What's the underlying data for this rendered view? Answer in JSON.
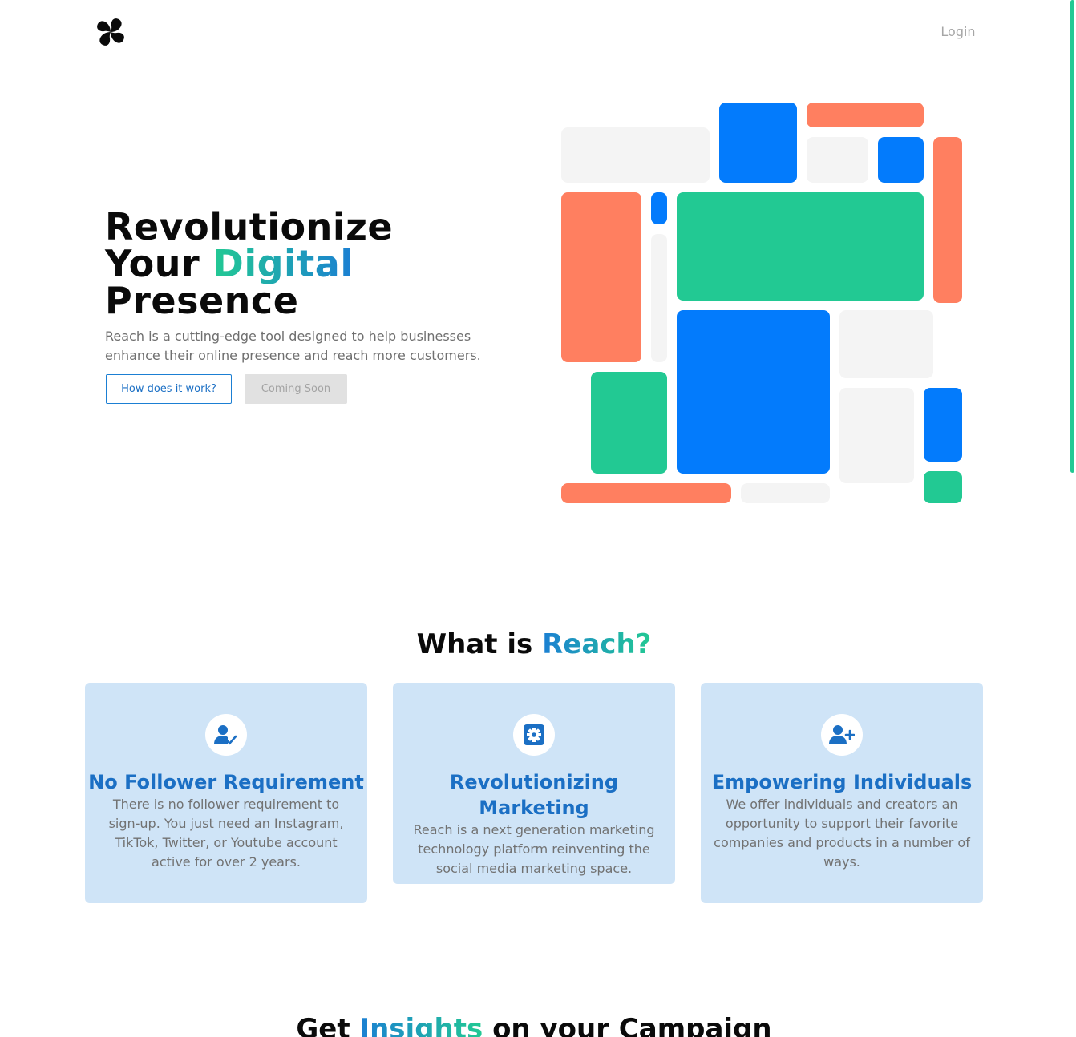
{
  "header": {
    "login_label": "Login"
  },
  "hero": {
    "title_line1": "Revolutionize",
    "title_line2_prefix": "Your ",
    "title_line2_highlight": "Digital",
    "title_line3": "Presence",
    "description": "Reach is a cutting-edge tool designed to help businesses enhance their online presence and reach more customers.",
    "primary_button": "How does it work?",
    "secondary_button": "Coming Soon"
  },
  "about": {
    "title_prefix": "What is ",
    "title_highlight": "Reach?",
    "cards": [
      {
        "icon": "user-check-icon",
        "title": "No Follower Requirement",
        "text": "There is no follower requirement to sign-up. You just need an Instagram, TikTok, Twitter, or Youtube account active for over 2 years."
      },
      {
        "icon": "gear-icon",
        "title": "Revolutionizing Marketing",
        "text": "Reach is a next generation marketing technology platform reinventing the social media marketing space."
      },
      {
        "icon": "user-plus-icon",
        "title": "Empowering Individuals",
        "text": "We offer individuals and creators an opportunity to support their favorite companies and products in a number of ways."
      }
    ]
  },
  "insights": {
    "title_prefix": "Get ",
    "title_highlight": "Insights",
    "title_suffix": " on your Campaign"
  },
  "colors": {
    "blue": "#037bfc",
    "orange": "#ff7f60",
    "green": "#22c993",
    "gray": "#f4f4f4",
    "card_bg": "#cfe4f7",
    "accent_text": "#1b6fc4"
  }
}
